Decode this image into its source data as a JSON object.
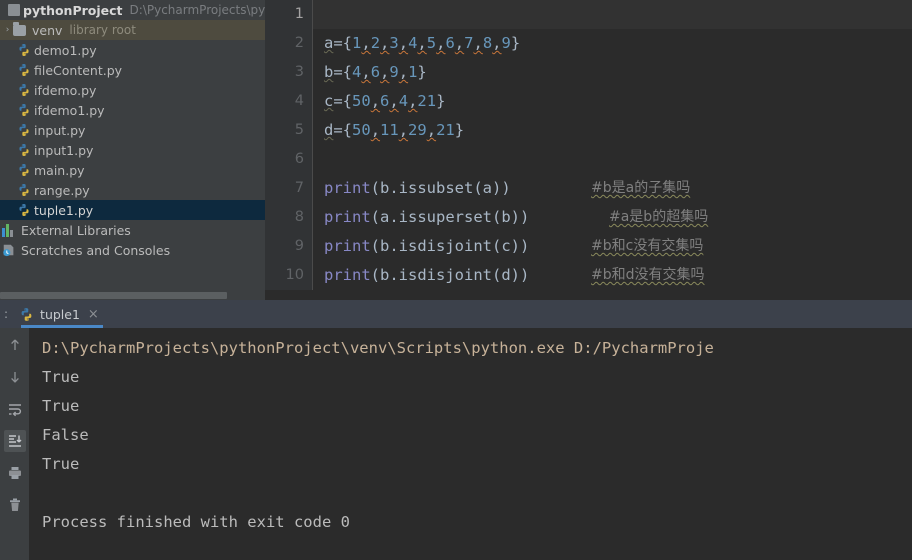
{
  "sidebar": {
    "project": {
      "name": "pythonProject",
      "path": "D:\\PycharmProjects\\python",
      "icon": "module-icon"
    },
    "venv": {
      "label": "venv",
      "tag": "library root",
      "icon": "folder-icon",
      "arrow": "›"
    },
    "files": [
      {
        "label": "demo1.py",
        "icon": "python-file-icon"
      },
      {
        "label": "fileContent.py",
        "icon": "python-file-icon"
      },
      {
        "label": "ifdemo.py",
        "icon": "python-file-icon"
      },
      {
        "label": "ifdemo1.py",
        "icon": "python-file-icon"
      },
      {
        "label": "input.py",
        "icon": "python-file-icon"
      },
      {
        "label": "input1.py",
        "icon": "python-file-icon"
      },
      {
        "label": "main.py",
        "icon": "python-file-icon"
      },
      {
        "label": "range.py",
        "icon": "python-file-icon"
      },
      {
        "label": "tuple1.py",
        "icon": "python-file-icon",
        "selected": true
      }
    ],
    "external_libraries": {
      "label": "External Libraries",
      "icon": "libraries-icon"
    },
    "scratches": {
      "label": "Scratches and Consoles",
      "icon": "scratches-icon"
    }
  },
  "editor": {
    "line_numbers": [
      "1",
      "2",
      "3",
      "4",
      "5",
      "6",
      "7",
      "8",
      "9",
      "10"
    ],
    "lines": [
      {
        "n": "1",
        "text": "",
        "current": true
      },
      {
        "n": "2",
        "text": "a={1,2,3,4,5,6,7,8,9}"
      },
      {
        "n": "3",
        "text": "b={4,6,9,1}"
      },
      {
        "n": "4",
        "text": "c={50,6,4,21}"
      },
      {
        "n": "5",
        "text": "d={50,11,29,21}"
      },
      {
        "n": "6",
        "text": ""
      },
      {
        "n": "7",
        "text": "print(b.issubset(a))",
        "comment": "#b是a的子集吗"
      },
      {
        "n": "8",
        "text": "print(a.issuperset(b))",
        "comment": "#a是b的超集吗"
      },
      {
        "n": "9",
        "text": "print(b.isdisjoint(c))",
        "comment": "#b和c没有交集吗"
      },
      {
        "n": "10",
        "text": "print(b.isdisjoint(d))",
        "comment": "#b和d没有交集吗"
      }
    ],
    "sets": {
      "a": {
        "name": "a",
        "values": [
          "1",
          "2",
          "3",
          "4",
          "5",
          "6",
          "7",
          "8",
          "9"
        ]
      },
      "b": {
        "name": "b",
        "values": [
          "4",
          "6",
          "9",
          "1"
        ]
      },
      "c": {
        "name": "c",
        "values": [
          "50",
          "6",
          "4",
          "21"
        ]
      },
      "d": {
        "name": "d",
        "values": [
          "50",
          "11",
          "29",
          "21"
        ]
      }
    },
    "calls": [
      {
        "fn": "print",
        "arg": "b.issubset(a)",
        "comment": "#b是a的子集吗"
      },
      {
        "fn": "print",
        "arg": "a.issuperset(b)",
        "comment": "#a是b的超集吗"
      },
      {
        "fn": "print",
        "arg": "b.isdisjoint(c)",
        "comment": "#b和c没有交集吗"
      },
      {
        "fn": "print",
        "arg": "b.isdisjoint(d)",
        "comment": "#b和d没有交集吗"
      }
    ]
  },
  "console": {
    "colon": ":",
    "tab": {
      "label": "tuple1",
      "icon": "python-file-icon",
      "close": "×"
    },
    "toolbar": [
      {
        "name": "up-arrow-icon",
        "glyph": "↑",
        "active": false
      },
      {
        "name": "down-arrow-icon",
        "glyph": "↓",
        "active": false
      },
      {
        "name": "soft-wrap-icon",
        "glyph": "",
        "active": false
      },
      {
        "name": "scroll-to-end-icon",
        "glyph": "",
        "active": true
      },
      {
        "name": "print-icon",
        "glyph": "",
        "active": false
      },
      {
        "name": "trash-icon",
        "glyph": "",
        "active": false
      }
    ],
    "output": [
      {
        "text": "D:\\PycharmProjects\\pythonProject\\venv\\Scripts\\python.exe D:/PycharmProje",
        "kind": "cmd"
      },
      {
        "text": "True",
        "kind": "out"
      },
      {
        "text": "True",
        "kind": "out"
      },
      {
        "text": "False",
        "kind": "out"
      },
      {
        "text": "True",
        "kind": "out"
      },
      {
        "text": "",
        "kind": "blank"
      },
      {
        "text": "Process finished with exit code 0",
        "kind": "out"
      }
    ]
  },
  "colors": {
    "editor_bg": "#2b2b2b",
    "sidebar_bg": "#3c3f41",
    "gutter_bg": "#313335",
    "selection_bg": "#0d293e",
    "venv_bg": "#4e4b3f",
    "tabbar_bg": "#3c414b",
    "accent": "#4a88c7",
    "number_token": "#6897bb",
    "builtin_token": "#8888c6",
    "text_token": "#a9b7c6",
    "comment_token": "#808080",
    "console_text": "#bbbbbb",
    "console_cmd": "#c7b299"
  }
}
